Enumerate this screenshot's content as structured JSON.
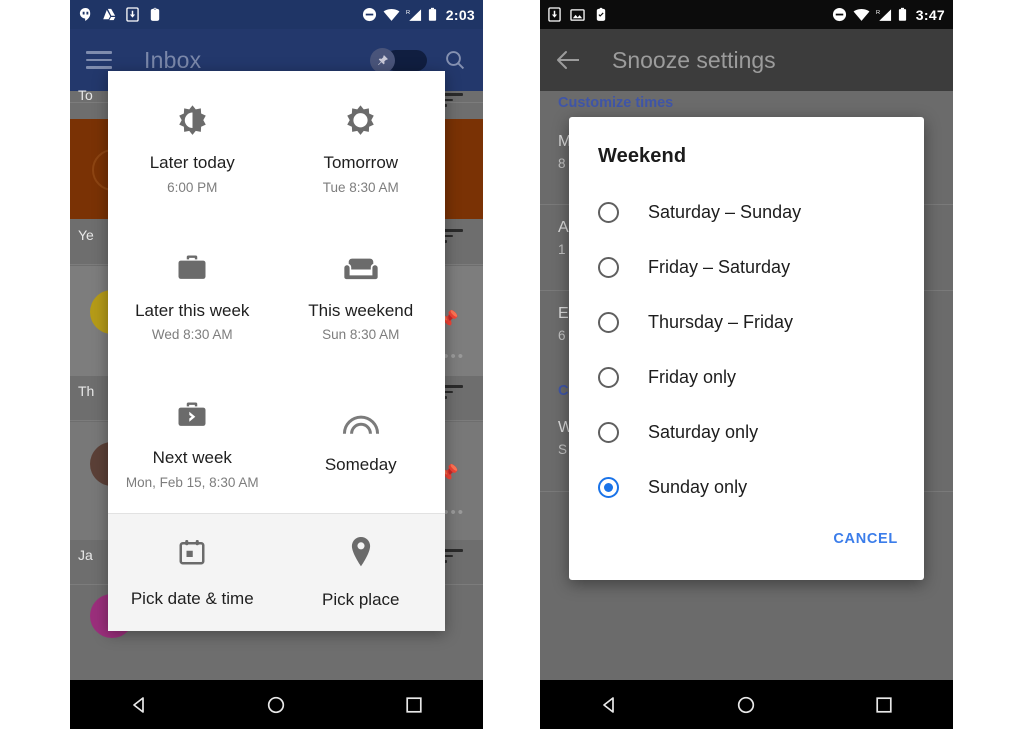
{
  "left_phone": {
    "status_bar": {
      "time": "2:03",
      "left_icons": [
        "hangouts-icon",
        "google-drive-icon",
        "download-icon",
        "clipboard-icon"
      ],
      "right_icons": [
        "do-not-disturb-icon",
        "wifi-icon",
        "cellular-roaming-icon",
        "battery-icon"
      ]
    },
    "app_bar": {
      "menu_icon": "hamburger-menu-icon",
      "title": "Inbox",
      "pin_toggle_icon": "pin-icon",
      "search_icon": "search-icon"
    },
    "background_list": {
      "sections": [
        {
          "label": "To"
        },
        {
          "label": "Ye"
        },
        {
          "label": "Th"
        },
        {
          "label": "Ja"
        }
      ]
    },
    "snooze_dialog": {
      "options": [
        {
          "icon": "half-sun-icon",
          "label": "Later today",
          "sub": "6:00 PM"
        },
        {
          "icon": "sun-icon",
          "label": "Tomorrow",
          "sub": "Tue 8:30 AM"
        },
        {
          "icon": "briefcase-icon",
          "label": "Later this week",
          "sub": "Wed 8:30 AM"
        },
        {
          "icon": "sofa-icon",
          "label": "This weekend",
          "sub": "Sun 8:30 AM"
        },
        {
          "icon": "briefcase-arrow-icon",
          "label": "Next week",
          "sub": "Mon, Feb 15, 8:30 AM"
        },
        {
          "icon": "rainbow-arc-icon",
          "label": "Someday",
          "sub": ""
        }
      ],
      "footer": [
        {
          "icon": "calendar-icon",
          "label": "Pick date & time"
        },
        {
          "icon": "place-pin-icon",
          "label": "Pick place"
        }
      ]
    },
    "nav_bar": {
      "back": "back-triangle-icon",
      "home": "home-circle-icon",
      "recents": "recents-square-icon"
    }
  },
  "right_phone": {
    "status_bar": {
      "time": "3:47",
      "left_icons": [
        "download-icon",
        "image-icon",
        "clipboard-check-icon"
      ],
      "right_icons": [
        "do-not-disturb-icon",
        "wifi-icon",
        "cellular-roaming-icon",
        "battery-icon"
      ]
    },
    "app_bar": {
      "back_icon": "back-arrow-icon",
      "title": "Snooze settings"
    },
    "background_settings": {
      "header": "Customize times",
      "rows": [
        {
          "title": "M",
          "sub": "8"
        },
        {
          "title": "A",
          "sub": "1"
        },
        {
          "title": "E",
          "sub": "6"
        }
      ],
      "header2": "C",
      "row2": {
        "title": "W",
        "sub": "S"
      }
    },
    "weekend_dialog": {
      "title": "Weekend",
      "options": [
        {
          "label": "Saturday – Sunday",
          "selected": false
        },
        {
          "label": "Friday – Saturday",
          "selected": false
        },
        {
          "label": "Thursday – Friday",
          "selected": false
        },
        {
          "label": "Friday only",
          "selected": false
        },
        {
          "label": "Saturday only",
          "selected": false
        },
        {
          "label": "Sunday only",
          "selected": true
        }
      ],
      "cancel_label": "CANCEL",
      "accent_color": "#1a73e8"
    },
    "nav_bar": {
      "back": "back-triangle-icon",
      "home": "home-circle-icon",
      "recents": "recents-square-icon"
    }
  }
}
